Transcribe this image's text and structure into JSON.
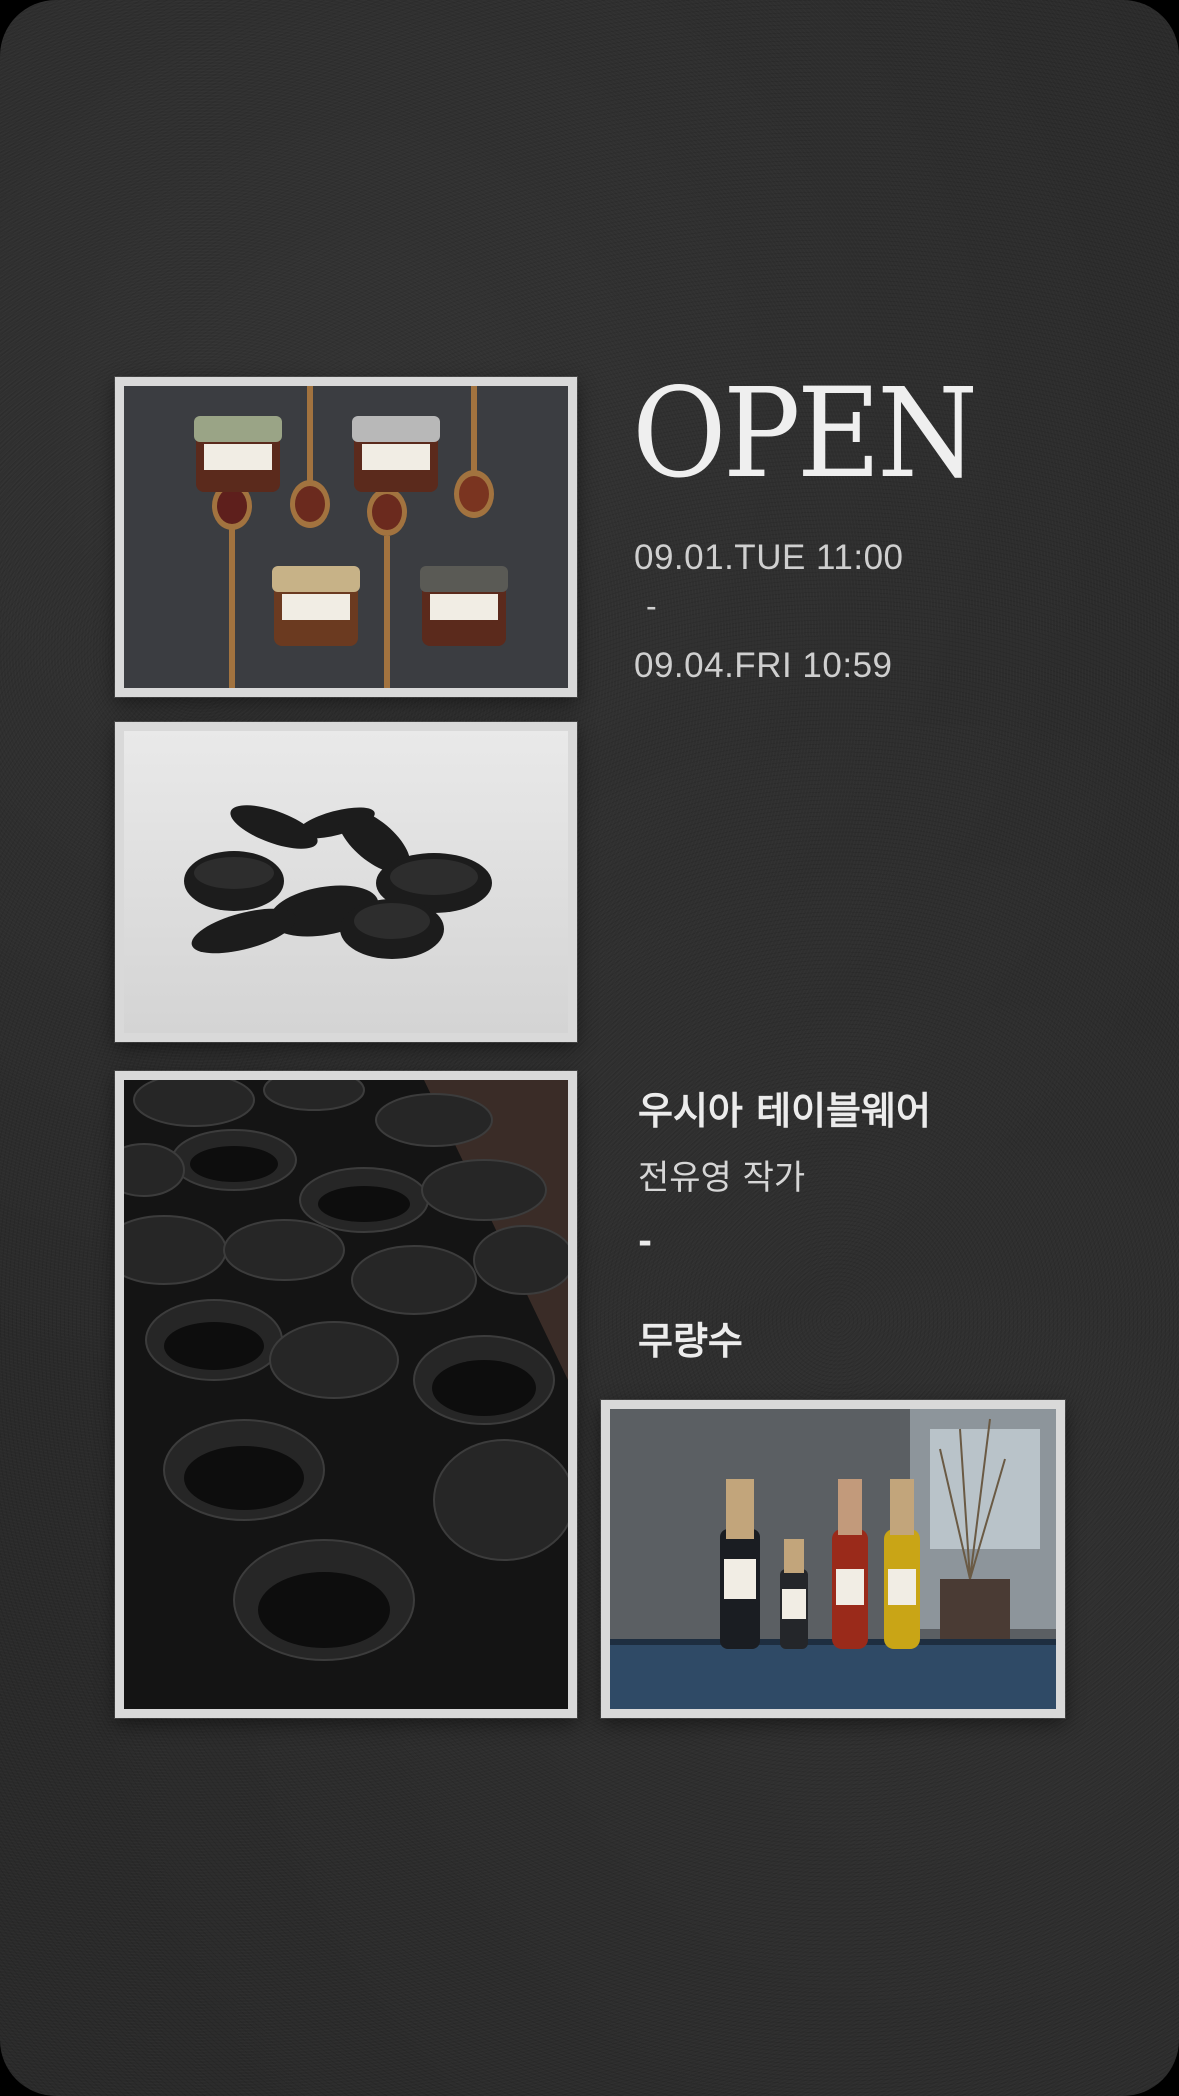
{
  "hero": {
    "title": "OPEN",
    "date_start": "09.01.TUE 11:00",
    "date_separator": "-",
    "date_end": "09.04.FRI 10:59"
  },
  "info": {
    "brand": "우시아 테이블웨어",
    "artist": "전유영 작가",
    "separator": "-",
    "partner": "무량수"
  },
  "photos": [
    {
      "subject": "jars-and-spoons-photo"
    },
    {
      "subject": "black-dishes-photo"
    },
    {
      "subject": "black-bowls-photo"
    },
    {
      "subject": "bottles-photo"
    }
  ],
  "colors": {
    "background": "#2a2a2a",
    "frame": "#d9d9d9",
    "text": "#efefef"
  }
}
